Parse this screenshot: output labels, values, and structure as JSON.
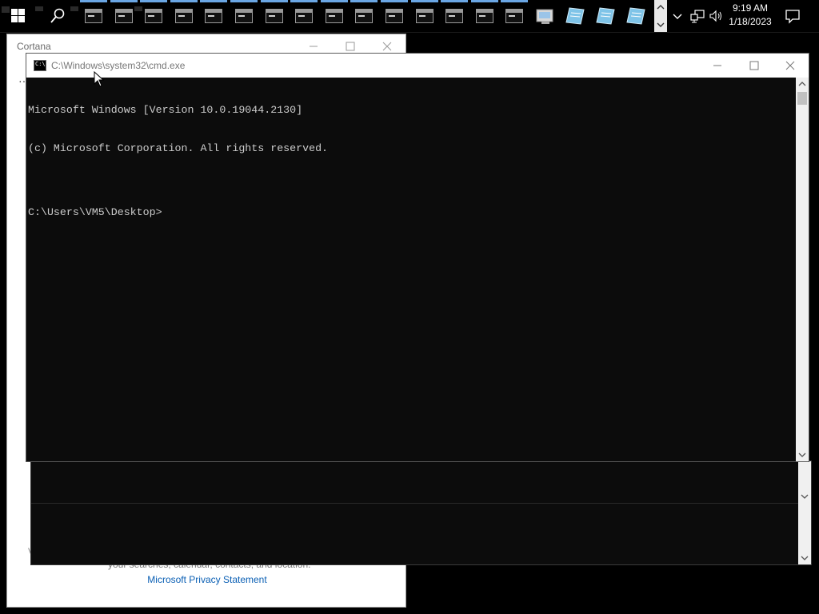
{
  "taskbar": {
    "clock_time": "9:19 AM",
    "clock_date": "1/18/2023",
    "app_icons": [
      "cmd-icon",
      "cmd-icon",
      "cmd-icon",
      "cmd-icon",
      "cmd-icon",
      "cmd-icon",
      "cmd-icon",
      "cmd-icon",
      "cmd-icon",
      "cmd-icon",
      "cmd-icon",
      "cmd-icon",
      "cmd-icon",
      "cmd-icon",
      "cmd-icon"
    ],
    "pinned_icons": [
      "control-panel-icon",
      "notepad-icon",
      "notepad-icon",
      "notepad-icon"
    ],
    "accent": "#6aa6e4"
  },
  "cortana_window": {
    "title": "Cortana",
    "partial_letter": "V",
    "partial_text": "your searches, calendar, contacts, and location.",
    "privacy_link": "Microsoft Privacy Statement"
  },
  "cmd_window": {
    "title": "C:\\Windows\\system32\\cmd.exe",
    "lines": [
      "Microsoft Windows [Version 10.0.19044.2130]",
      "(c) Microsoft Corporation. All rights reserved.",
      "",
      "C:\\Users\\VM5\\Desktop>"
    ],
    "background": "#0c0c0c",
    "text_color": "#cccccc"
  }
}
